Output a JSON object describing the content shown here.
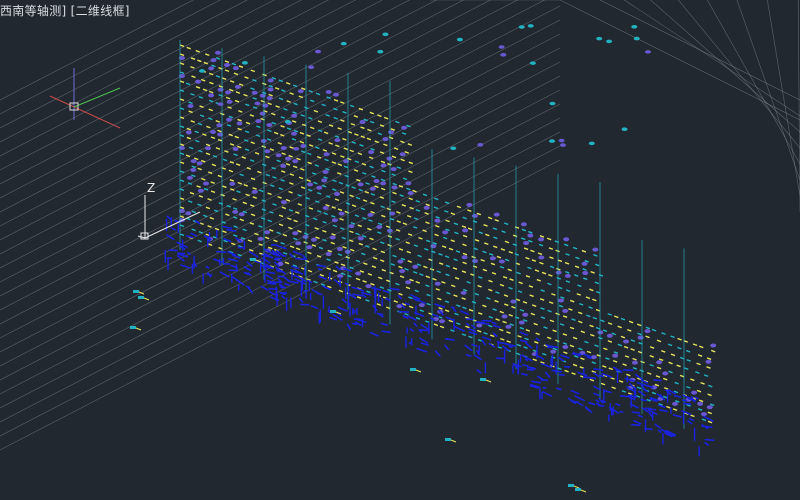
{
  "viewport": {
    "view_controls": {
      "view_label": "西南等轴测]",
      "style_label": "[二维线框]"
    },
    "background_color": "#212830"
  },
  "ucs_icon": {
    "axis_label": "Z"
  },
  "colors": {
    "yellow": "#e8e45a",
    "cyan": "#22b3c2",
    "blue": "#1a22e0",
    "purple": "#6a58d2",
    "grid": "#8e949a",
    "white": "#e8e8e8"
  }
}
